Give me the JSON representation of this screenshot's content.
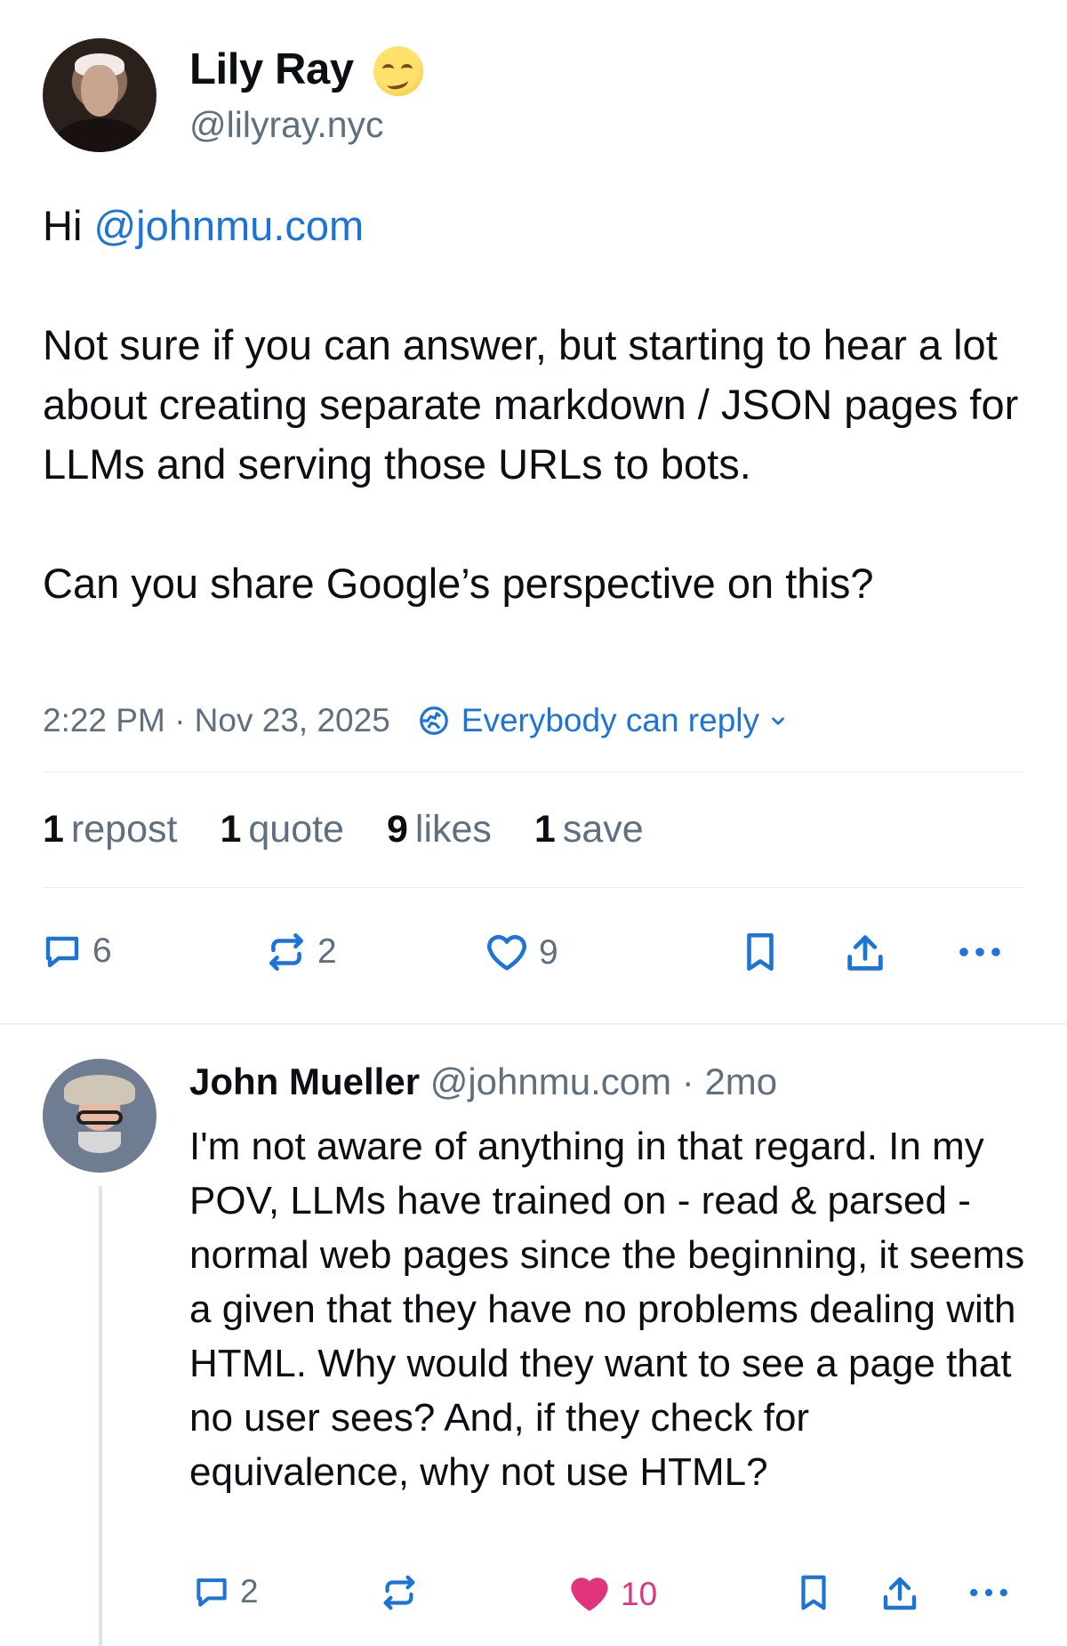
{
  "post": {
    "author": {
      "name": "Lily Ray",
      "handle": "@lilyray.nyc",
      "emoji": "smirking-face"
    },
    "text": {
      "greeting": "Hi ",
      "mention": "@johnmu.com",
      "body": "Not sure if you can answer, but starting to hear a lot about creating separate markdown / JSON pages for LLMs and serving those URLs to bots.\n\nCan you share Google’s perspective on this?"
    },
    "timestamp": "2:22 PM · Nov 23, 2025",
    "reply_setting": "Everybody can reply",
    "stats": [
      {
        "count": "1",
        "label": "repost"
      },
      {
        "count": "1",
        "label": "quote"
      },
      {
        "count": "9",
        "label": "likes"
      },
      {
        "count": "1",
        "label": "save"
      }
    ],
    "actions": {
      "replies": "6",
      "reposts": "2",
      "likes": "9"
    }
  },
  "reply": {
    "author": {
      "name": "John Mueller",
      "handle": "@johnmu.com",
      "time": "· 2mo"
    },
    "text": "I'm not aware of anything in that regard. In my POV, LLMs have trained on - read & parsed - normal web pages since the beginning, it seems a given that they have no problems dealing with HTML. Why would they want to see a page that no user sees? And, if they check for equivalence, why not use HTML?",
    "actions": {
      "replies": "2",
      "likes": "10"
    }
  },
  "colors": {
    "text": "#0b0f14",
    "muted": "#5e6f80",
    "accent": "#1d74d8",
    "like": "#e0347c",
    "divider": "#e9eef2"
  }
}
